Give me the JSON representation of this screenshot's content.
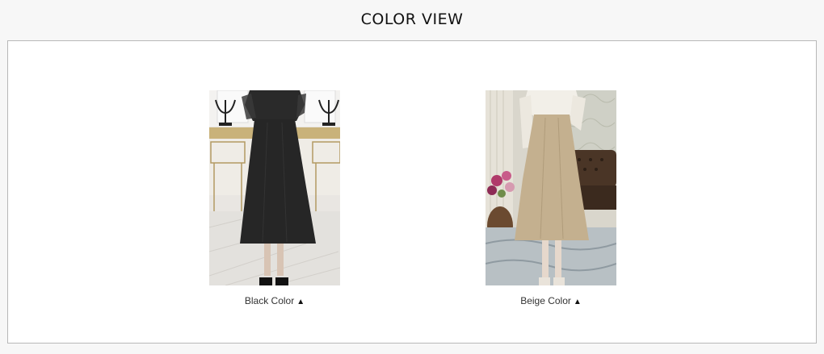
{
  "section": {
    "title": "COLOR VIEW"
  },
  "products": [
    {
      "caption": "Black Color",
      "arrow": "▲",
      "color": "#2b2b2b"
    },
    {
      "caption": "Beige Color",
      "arrow": "▲",
      "color": "#c9b595"
    }
  ]
}
